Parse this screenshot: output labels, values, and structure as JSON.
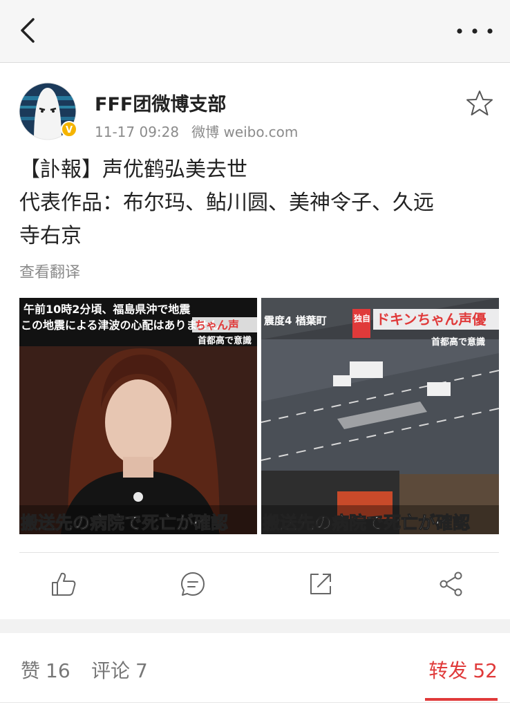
{
  "post": {
    "author": "FFF团微博支部",
    "time": "11-17 09:28",
    "source": "微博 weibo.com",
    "text_lines": [
      "【訃報】声优鹤弘美去世",
      "代表作品：布尔玛、鲇川圆、美神令子、久远",
      "寺右京"
    ],
    "translate_label": "查看翻译",
    "verified_badge": "V"
  },
  "images": [
    {
      "caption_top_1": "午前10時2分頃、福島県沖で地震",
      "caption_top_2": "この地震による津波の心配はありません",
      "caption_top_3": "首都高で意識",
      "banner": "ちゃん声",
      "caption_bottom": "搬送先の病院で死亡が確認"
    },
    {
      "caption_top_1": "震度4 楢葉町",
      "badge": "独自",
      "banner": "ドキンちゃん声優",
      "caption_top_3": "首都高で意識",
      "caption_bottom": "搬送先の病院で死亡が確認"
    }
  ],
  "actions": [
    "like-icon",
    "comment-icon",
    "repost-icon",
    "share-icon"
  ],
  "stats": {
    "likes_label": "赞",
    "likes": "16",
    "comments_label": "评论",
    "comments": "7",
    "reposts_label": "转发",
    "reposts": "52"
  },
  "colors": {
    "accent": "#e03a3a",
    "muted": "#8b8b8b",
    "nav_bg": "#f6f6f6",
    "badge": "#f5b400"
  },
  "icons": [
    "back-icon",
    "more-icon",
    "star-icon"
  ]
}
